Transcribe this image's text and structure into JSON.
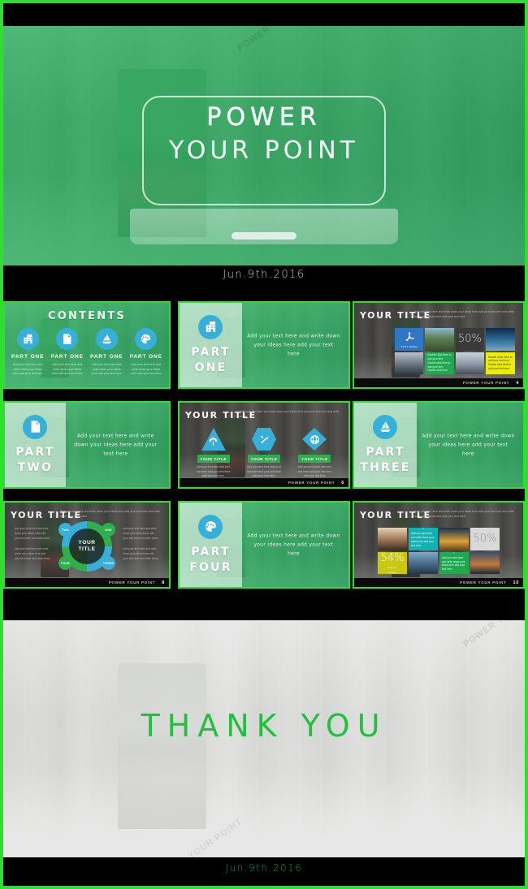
{
  "colors": {
    "frame_green": "#2ee02e",
    "brand_green": "#2fae4d",
    "brand_blue": "#36b0d8",
    "overlay_green": "#3cbe6e",
    "thanks_green": "#22c03f",
    "dark_slide": "#2b2b2b",
    "yellow": "#ecec0a",
    "teal": "#12b2b2"
  },
  "hero": {
    "title_line1": "POWER",
    "title_line2": "YOUR POINT",
    "date": "Jun.9th.2016"
  },
  "footer_brand": "POWER YOUR POINT",
  "contents_slide": {
    "title": "CONTENTS",
    "items": [
      {
        "label": "PART ONE",
        "icon": "building-icon",
        "body": "Add your text here and write down your ideas here add your text here"
      },
      {
        "label": "PART ONE",
        "icon": "document-icon",
        "body": "Add your text here and write down your ideas here add your text here"
      },
      {
        "label": "PART ONE",
        "icon": "sailboat-icon",
        "body": "Add your text here and write down your ideas here add your text here"
      },
      {
        "label": "PART ONE",
        "icon": "palette-icon",
        "body": "Add your text here and write down your ideas here add your text here"
      }
    ]
  },
  "dividers": {
    "one": {
      "word1": "PART",
      "word2": "ONE",
      "icon": "building-icon",
      "body": "Add your text here and write down your ideas here add your text here"
    },
    "two": {
      "word1": "PART",
      "word2": "TWO",
      "icon": "document-icon",
      "body": "Add your text here and write down your ideas here add your text here"
    },
    "three": {
      "word1": "PART",
      "word2": "THREE",
      "icon": "sailboat-icon",
      "body": "Add your text here and write down your ideas here add your text here"
    },
    "four": {
      "word1": "PART",
      "word2": "FOUR",
      "icon": "palette-icon",
      "body": "Add your text here and write down your ideas here add your text here"
    }
  },
  "mosaic_slide_4": {
    "title": "YOUR TITLE",
    "subtitle": "Add your text here and write down your ideas here add your text here and write down your ideas here add your text here",
    "page": "4",
    "tiles": [
      {
        "kind": "blue",
        "label": "TEXT HERE",
        "icon": "acrobat-icon"
      },
      {
        "kind": "photo-a",
        "label": ""
      },
      {
        "kind": "grey",
        "value": "50%"
      },
      {
        "kind": "photo-b",
        "label": ""
      },
      {
        "kind": "photo-c",
        "label": ""
      },
      {
        "kind": "green",
        "text": "Double Click Here to add your text. Double click here to add your text. Double click here."
      },
      {
        "kind": "photo-f",
        "label": ""
      },
      {
        "kind": "yellow",
        "text": "Double Click Here to add your text here.  Double click here to add your text here."
      }
    ]
  },
  "shapes_slide_6": {
    "title": "YOUR TITLE",
    "subtitle": "Add your text here and write down your ideas here add your text here and write down",
    "page": "6",
    "items": [
      {
        "shape": "triangle",
        "icon": "umbrella-icon",
        "badge": "YOUR TITLE",
        "body": "Add your text here add your text here add your text here add your text here"
      },
      {
        "shape": "hexagon",
        "icon": "tools-icon",
        "badge": "YOUR TITLE",
        "body": "Add your text here add your text here add your text here add your text here"
      },
      {
        "shape": "diamond",
        "icon": "globe-icon",
        "badge": "YOUR TITLE",
        "body": "Add your text here add your text here add your text here add your text here"
      }
    ]
  },
  "donut_slide_8": {
    "title": "YOUR TITLE",
    "subtitle": "Add your text here and write down your ideas here add your text here and write down your ideas here",
    "center_line1": "YOUR",
    "center_line2": "TITLE",
    "page": "8",
    "bubbles": [
      {
        "label": "ONE"
      },
      {
        "label": "TWO"
      },
      {
        "label": "FOUR"
      },
      {
        "label": "THREE"
      }
    ],
    "left_paragraphs": [
      "Add your text here and write down your ideas here add your text here and write down",
      "Add your text here and write down your ideas here add your text here and write down"
    ],
    "right_paragraphs": [
      "Add your text here and write down your ideas here add your text here and write down",
      "Add your text here and write down your ideas here add your text here and write down"
    ]
  },
  "mosaic_slide_10": {
    "title": "YOUR TITLE",
    "subtitle": "Add your text here and write down your ideas here add your text here and write down your ideas here add your text here",
    "page": "10",
    "tiles": [
      {
        "kind": "photo-d",
        "label": ""
      },
      {
        "kind": "teal",
        "icon": "wrench-icon",
        "text": "Add your text here and write down your ideas here add your text here"
      },
      {
        "kind": "photo-g",
        "label": ""
      },
      {
        "kind": "white",
        "value": "50%"
      },
      {
        "kind": "olive",
        "value": "54%",
        "sub1": "Power",
        "sub2": "Point"
      },
      {
        "kind": "photo-e",
        "label": ""
      },
      {
        "kind": "green",
        "icon": "cart-icon",
        "text": "Add your text here and write down your ideas here add your text here"
      },
      {
        "kind": "photo-h",
        "label": ""
      }
    ]
  },
  "thanks": {
    "title": "THANK YOU",
    "date": "Jun.9th.2016"
  }
}
